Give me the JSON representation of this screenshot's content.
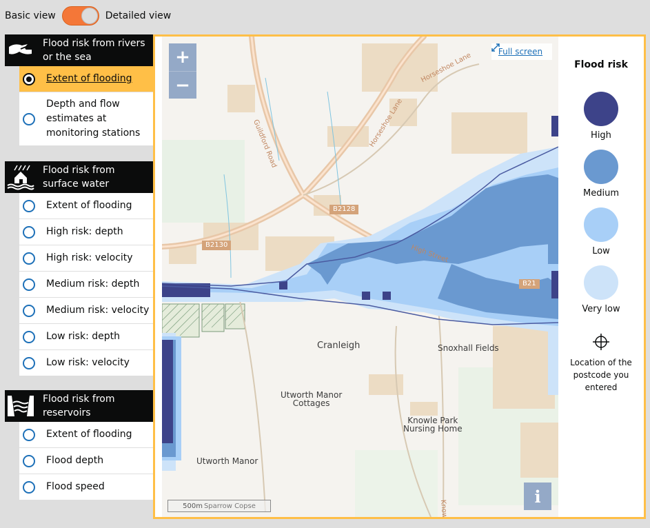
{
  "toggle": {
    "left_label": "Basic view",
    "right_label": "Detailed view",
    "state": "detailed"
  },
  "sidebar": {
    "groups": [
      {
        "title": "Flood risk from rivers or the sea",
        "icon": "river-icon",
        "options": [
          {
            "label": "Extent of flooding",
            "selected": true
          },
          {
            "label": "Depth and flow estimates at monitoring stations",
            "selected": false
          }
        ]
      },
      {
        "title": "Flood risk from surface water",
        "icon": "surface-water-icon",
        "options": [
          {
            "label": "Extent of flooding",
            "selected": false
          },
          {
            "label": "High risk: depth",
            "selected": false
          },
          {
            "label": "High risk: velocity",
            "selected": false
          },
          {
            "label": "Medium risk: depth",
            "selected": false
          },
          {
            "label": "Medium risk: velocity",
            "selected": false
          },
          {
            "label": "Low risk: depth",
            "selected": false
          },
          {
            "label": "Low risk: velocity",
            "selected": false
          }
        ]
      },
      {
        "title": "Flood risk from reservoirs",
        "icon": "reservoir-icon",
        "options": [
          {
            "label": "Extent of flooding",
            "selected": false
          },
          {
            "label": "Flood depth",
            "selected": false
          },
          {
            "label": "Flood speed",
            "selected": false
          }
        ]
      }
    ]
  },
  "map": {
    "zoom_in": "+",
    "zoom_out": "−",
    "fullscreen": "Full screen",
    "scale": "500m",
    "scale_overlay": "Sparrow Copse",
    "info": "i",
    "places": {
      "cranleigh": "Cranleigh",
      "snoxhall": "Snoxhall Fields",
      "utworth_cottages_1": "Utworth Manor",
      "utworth_cottages_2": "Cottages",
      "knowle_1": "Knowle Park",
      "knowle_2": "Nursing Home",
      "utworth_manor": "Utworth Manor"
    },
    "roads": {
      "b2128": "B2128",
      "b2130": "B2130",
      "b21_edge": "B21",
      "guildford": "Guildford Road",
      "horseshoe1": "Horseshoe Lane",
      "horseshoe2": "Horseshoe Lane",
      "high_street": "High Street",
      "knowle": "Know"
    }
  },
  "legend": {
    "title": "Flood risk",
    "items": [
      {
        "label": "High",
        "color": "#3d4389"
      },
      {
        "label": "Medium",
        "color": "#6a99d0"
      },
      {
        "label": "Low",
        "color": "#a8cff7"
      },
      {
        "label": "Very low",
        "color": "#cde3f9"
      }
    ],
    "location_label": "Location of the postcode you entered"
  },
  "colors": {
    "accent": "#ffbf47",
    "link": "#1d70b8",
    "toggle": "#f47738"
  }
}
